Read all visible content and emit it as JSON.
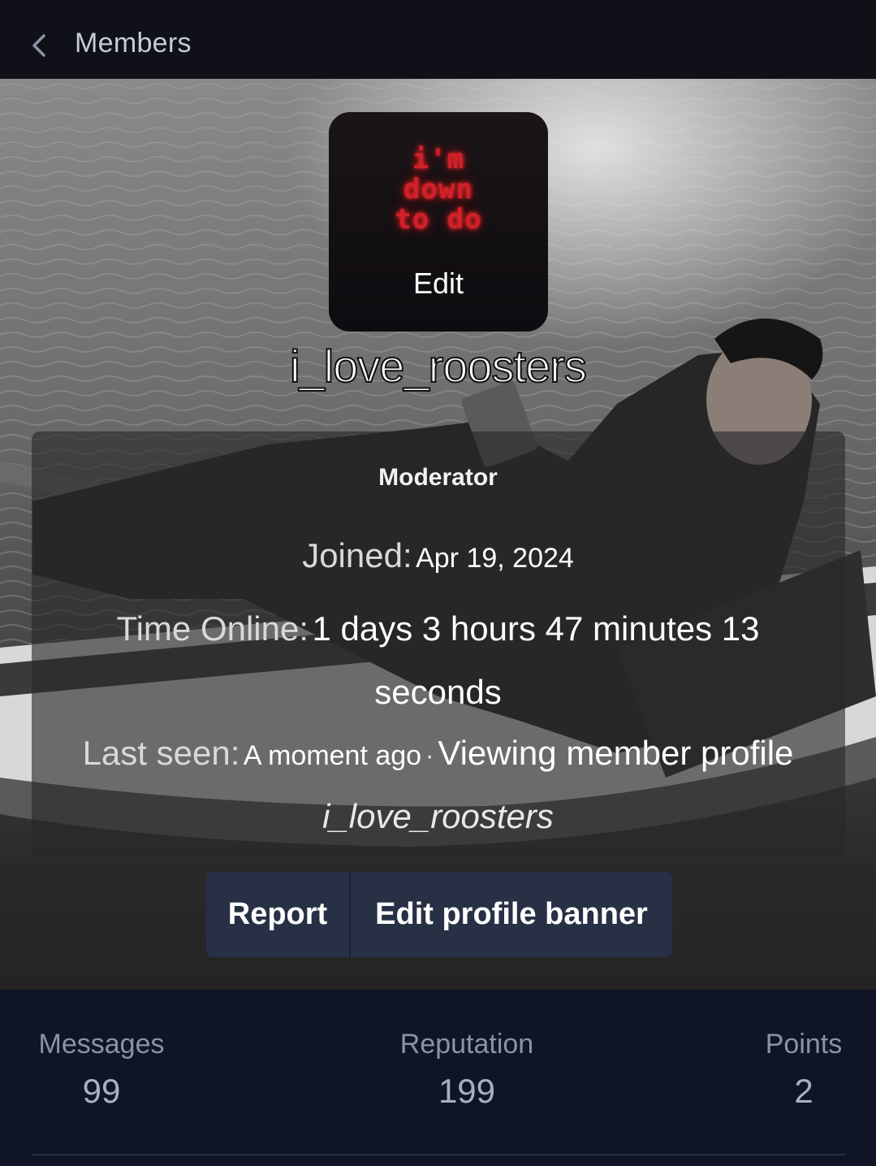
{
  "header": {
    "back_label": "Members"
  },
  "profile": {
    "avatar_art_lines": [
      "i'm",
      "down",
      "to do"
    ],
    "avatar_edit_label": "Edit",
    "username": "i_love_roosters",
    "role": "Moderator",
    "joined_label": "Joined:",
    "joined_value": "Apr 19, 2024",
    "time_online_label": "Time Online:",
    "time_online_value": "1 days 3 hours 47 minutes 13 seconds",
    "last_seen_label": "Last seen:",
    "last_seen_value": "A moment ago",
    "separator": "·",
    "activity_text": "Viewing member profile",
    "activity_link": "i_love_roosters"
  },
  "actions": {
    "report_label": "Report",
    "edit_banner_label": "Edit profile banner"
  },
  "stats": {
    "messages_label": "Messages",
    "messages_value": "99",
    "reputation_label": "Reputation",
    "reputation_value": "199",
    "points_label": "Points",
    "points_value": "2"
  },
  "colors": {
    "topbar": "#0f1018",
    "button": "#273045",
    "stats_bg": "#0f1524",
    "avatar_text": "#d0202a"
  }
}
